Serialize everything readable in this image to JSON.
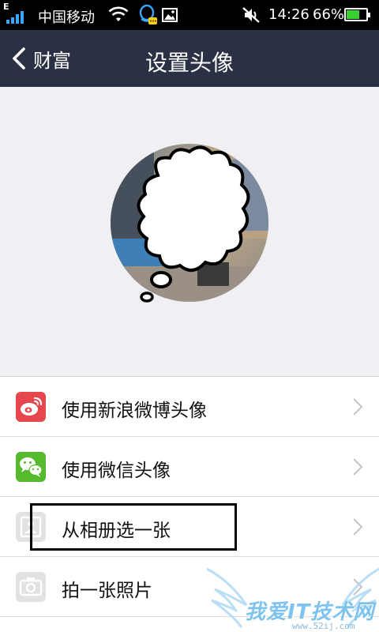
{
  "status_bar": {
    "network_type": "E",
    "carrier": "中国移动",
    "time": "14:26",
    "battery_percent": "66%",
    "battery_level": 0.66,
    "icons": [
      "signal-icon",
      "wifi-icon",
      "qq-notification-icon",
      "image-notification-icon",
      "mute-icon",
      "battery-icon"
    ]
  },
  "header": {
    "back_label": "财富",
    "title": "设置头像"
  },
  "avatar": {
    "icon": "avatar-photo-with-thought-bubble"
  },
  "options": [
    {
      "label": "使用新浪微博头像",
      "icon": "weibo-icon",
      "icon_color": "#e6474d"
    },
    {
      "label": "使用微信头像",
      "icon": "wechat-icon",
      "icon_color": "#55bb2c"
    },
    {
      "label": "从相册选一张",
      "icon": "album-icon",
      "icon_color": "#e2e2e2",
      "highlighted": true
    },
    {
      "label": "拍一张照片",
      "icon": "camera-icon",
      "icon_color": "#e2e2e2"
    }
  ],
  "watermark": {
    "text": "我爱IT技术网",
    "sub": "www.52ij.com"
  },
  "colors": {
    "header_bg": "#2b3144",
    "page_bg": "#efeff4",
    "accent_green": "#38d12f"
  }
}
